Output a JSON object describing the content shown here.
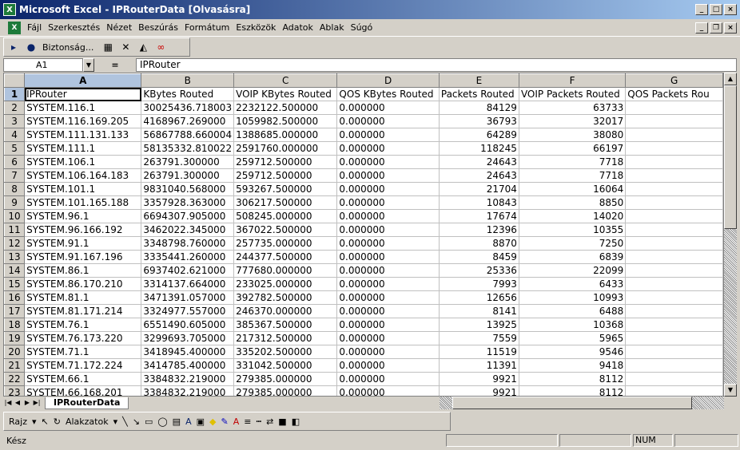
{
  "window": {
    "title": "Microsoft Excel - IPRouterData  [Olvasásra]",
    "app_icon": "X"
  },
  "menu": [
    "Fájl",
    "Szerkesztés",
    "Nézet",
    "Beszúrás",
    "Formátum",
    "Eszközök",
    "Adatok",
    "Ablak",
    "Súgó"
  ],
  "toolbar": {
    "security_label": "Biztonság..."
  },
  "formula": {
    "name_box": "A1",
    "fx": "=",
    "value": "IPRouter"
  },
  "columns": [
    "A",
    "B",
    "C",
    "D",
    "E",
    "F",
    "G"
  ],
  "rows": [
    [
      "IPRouter",
      "KBytes Routed",
      "VOIP KBytes Routed",
      "QOS KBytes Routed",
      "Packets Routed",
      "VOIP Packets Routed",
      "QOS Packets Rou"
    ],
    [
      "SYSTEM.116.1",
      "30025436.718003",
      "2232122.500000",
      "0.000000",
      "84129",
      "63733",
      ""
    ],
    [
      "SYSTEM.116.169.205",
      "4168967.269000",
      "1059982.500000",
      "0.000000",
      "36793",
      "32017",
      ""
    ],
    [
      "SYSTEM.111.131.133",
      "56867788.660004",
      "1388685.000000",
      "0.000000",
      "64289",
      "38080",
      ""
    ],
    [
      "SYSTEM.111.1",
      "58135332.810022",
      "2591760.000000",
      "0.000000",
      "118245",
      "66197",
      ""
    ],
    [
      "SYSTEM.106.1",
      "263791.300000",
      "259712.500000",
      "0.000000",
      "24643",
      "7718",
      ""
    ],
    [
      "SYSTEM.106.164.183",
      "263791.300000",
      "259712.500000",
      "0.000000",
      "24643",
      "7718",
      ""
    ],
    [
      "SYSTEM.101.1",
      "9831040.568000",
      "593267.500000",
      "0.000000",
      "21704",
      "16064",
      ""
    ],
    [
      "SYSTEM.101.165.188",
      "3357928.363000",
      "306217.500000",
      "0.000000",
      "10843",
      "8850",
      ""
    ],
    [
      "SYSTEM.96.1",
      "6694307.905000",
      "508245.000000",
      "0.000000",
      "17674",
      "14020",
      ""
    ],
    [
      "SYSTEM.96.166.192",
      "3462022.345000",
      "367022.500000",
      "0.000000",
      "12396",
      "10355",
      ""
    ],
    [
      "SYSTEM.91.1",
      "3348798.760000",
      "257735.000000",
      "0.000000",
      "8870",
      "7250",
      ""
    ],
    [
      "SYSTEM.91.167.196",
      "3335441.260000",
      "244377.500000",
      "0.000000",
      "8459",
      "6839",
      ""
    ],
    [
      "SYSTEM.86.1",
      "6937402.621000",
      "777680.000000",
      "0.000000",
      "25336",
      "22099",
      ""
    ],
    [
      "SYSTEM.86.170.210",
      "3314137.664000",
      "233025.000000",
      "0.000000",
      "7993",
      "6433",
      ""
    ],
    [
      "SYSTEM.81.1",
      "3471391.057000",
      "392782.500000",
      "0.000000",
      "12656",
      "10993",
      ""
    ],
    [
      "SYSTEM.81.171.214",
      "3324977.557000",
      "246370.000000",
      "0.000000",
      "8141",
      "6488",
      ""
    ],
    [
      "SYSTEM.76.1",
      "6551490.605000",
      "385367.500000",
      "0.000000",
      "13925",
      "10368",
      ""
    ],
    [
      "SYSTEM.76.173.220",
      "3299693.705000",
      "217312.500000",
      "0.000000",
      "7559",
      "5965",
      ""
    ],
    [
      "SYSTEM.71.1",
      "3418945.400000",
      "335202.500000",
      "0.000000",
      "11519",
      "9546",
      ""
    ],
    [
      "SYSTEM.71.172.224",
      "3414785.400000",
      "331042.500000",
      "0.000000",
      "11391",
      "9418",
      ""
    ],
    [
      "SYSTEM.66.1",
      "3384832.219000",
      "279385.000000",
      "0.000000",
      "9921",
      "8112",
      ""
    ],
    [
      "SYSTEM.66.168.201",
      "3384832.219000",
      "279385.000000",
      "0.000000",
      "9921",
      "8112",
      ""
    ]
  ],
  "sheet_tab": "IPRouterData",
  "drawbar": {
    "draw_label": "Rajz",
    "shapes_label": "Alakzatok"
  },
  "status": {
    "text": "Kész",
    "num": "NUM"
  }
}
